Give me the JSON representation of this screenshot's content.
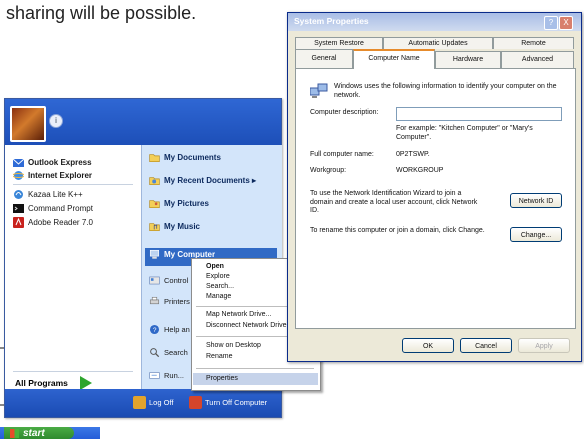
{
  "caption": "sharing will be possible.",
  "start_menu": {
    "username_icon": "info-icon",
    "left_items": [
      {
        "label": "Outlook Express",
        "icon": "outlook-icon",
        "bold": true
      },
      {
        "label": "Internet Explorer",
        "icon": "ie-icon",
        "bold": true
      },
      {
        "label": "Kazaa Lite K++",
        "icon": "kazaa-icon",
        "bold": false
      },
      {
        "label": "Command Prompt",
        "icon": "cmd-icon",
        "bold": false
      },
      {
        "label": "Adobe Reader 7.0",
        "icon": "adobe-icon",
        "bold": false
      }
    ],
    "right_items": [
      {
        "label": "My Documents"
      },
      {
        "label": "My Recent Documents  ▸"
      },
      {
        "label": "My Pictures"
      },
      {
        "label": "My Music"
      },
      {
        "label": "My Computer"
      },
      {
        "label": "Control"
      },
      {
        "label": "Printers"
      },
      {
        "label": "Help an"
      },
      {
        "label": "Search"
      },
      {
        "label": "Run..."
      }
    ],
    "all_programs": "All Programs",
    "log_off": "Log Off",
    "turn_off": "Turn Off Computer"
  },
  "context_menu": {
    "items": [
      "Open",
      "Explore",
      "Search...",
      "Manage",
      "Map Network Drive...",
      "Disconnect Network Drive...",
      "Show on Desktop",
      "Rename",
      "Properties"
    ]
  },
  "taskbar": {
    "start_label": "start"
  },
  "system_properties": {
    "title": "System Properties",
    "help": "?",
    "close": "X",
    "tabs_row1": [
      "System Restore",
      "Automatic Updates",
      "Remote"
    ],
    "tabs_row2": [
      "General",
      "Computer Name",
      "Hardware",
      "Advanced"
    ],
    "intro": "Windows uses the following information to identify your computer on the network.",
    "desc_label": "Computer description:",
    "example": "For example: \"Kitchen Computer\" or \"Mary's Computer\".",
    "full_name_label": "Full computer name:",
    "full_name_value": "0P2TSWP.",
    "workgroup_label": "Workgroup:",
    "workgroup_value": "WORKGROUP",
    "netid_text": "To use the Network Identification Wizard to join a domain and create a local user account, click Network ID.",
    "netid_button": "Network ID",
    "rename_text": "To rename this computer or join a domain, click Change.",
    "change_button": "Change...",
    "ok": "OK",
    "cancel": "Cancel",
    "apply": "Apply"
  },
  "colors": {
    "xp_blue": "#1d4fb8",
    "start_green": "#2f8a2e",
    "highlight": "#316ac5"
  }
}
